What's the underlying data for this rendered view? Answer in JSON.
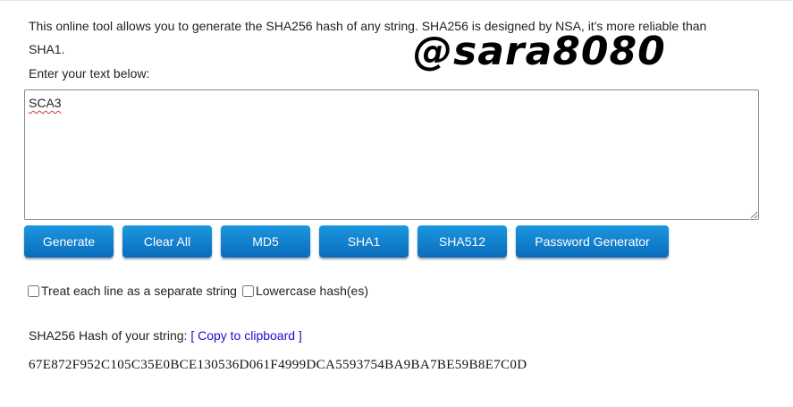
{
  "intro": {
    "text": "This online tool allows you to generate the SHA256 hash of any string. SHA256 is designed by NSA, it's more reliable than SHA1.",
    "enter_label": "Enter your text below:"
  },
  "watermark": "@sara8080",
  "input": {
    "value": "SCA3"
  },
  "buttons": {
    "generate": "Generate",
    "clear_all": "Clear All",
    "md5": "MD5",
    "sha1": "SHA1",
    "sha512": "SHA512",
    "password_generator": "Password Generator"
  },
  "options": {
    "separate_lines": "Treat each line as a separate string",
    "separate_lines_checked": false,
    "lowercase": "Lowercase hash(es)",
    "lowercase_checked": false
  },
  "result": {
    "label": "SHA256 Hash of your string:",
    "copy_link": "[ Copy to clipboard ]",
    "hash": "67E872F952C105C35E0BCE130536D061F4999DCA5593754BA9BA7BE59B8E7C0D"
  },
  "colors": {
    "button_top": "#1c97e0",
    "button_bottom": "#0a6cbc",
    "link": "#1a0dcc"
  }
}
